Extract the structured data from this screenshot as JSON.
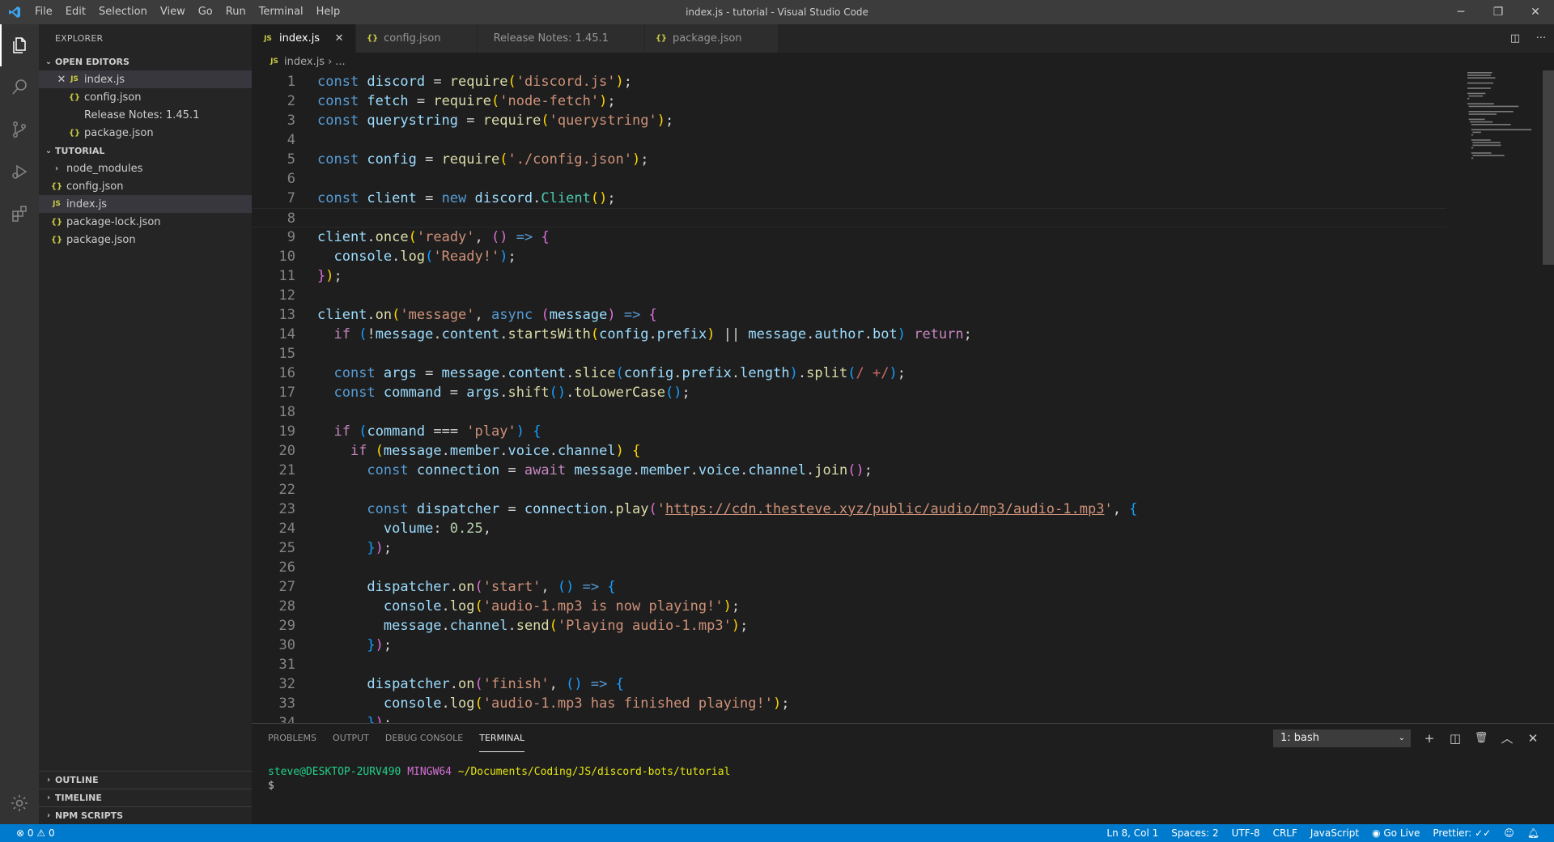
{
  "window": {
    "title": "index.js - tutorial - Visual Studio Code",
    "minimize": "─",
    "maximize": "❐",
    "close": "✕"
  },
  "menu": [
    "File",
    "Edit",
    "Selection",
    "View",
    "Go",
    "Run",
    "Terminal",
    "Help"
  ],
  "sidebar": {
    "title": "EXPLORER",
    "open_editors": {
      "header": "OPEN EDITORS",
      "items": [
        {
          "badge": "JS",
          "label": "index.js"
        },
        {
          "badge": "{}",
          "label": "config.json"
        },
        {
          "badge": "",
          "label": "Release Notes: 1.45.1"
        },
        {
          "badge": "{}",
          "label": "package.json"
        }
      ]
    },
    "workspace": {
      "header": "TUTORIAL",
      "items": [
        {
          "badge": "",
          "label": "node_modules"
        },
        {
          "badge": "{}",
          "label": "config.json"
        },
        {
          "badge": "JS",
          "label": "index.js"
        },
        {
          "badge": "{}",
          "label": "package-lock.json"
        },
        {
          "badge": "{}",
          "label": "package.json"
        }
      ]
    },
    "bottom_sections": [
      "OUTLINE",
      "TIMELINE",
      "NPM SCRIPTS"
    ]
  },
  "tabs": [
    {
      "badge": "JS",
      "label": "index.js"
    },
    {
      "badge": "{}",
      "label": "config.json"
    },
    {
      "badge": "",
      "label": "Release Notes: 1.45.1"
    },
    {
      "badge": "{}",
      "label": "package.json"
    }
  ],
  "tab_actions": {
    "split": "◫",
    "more": "···"
  },
  "breadcrumb": {
    "badge": "JS",
    "file": "index.js",
    "sep": "›",
    "rest": "..."
  },
  "code_lines": [
    [
      [
        "k",
        "const "
      ],
      [
        "v",
        "discord"
      ],
      [
        "o",
        " = "
      ],
      [
        "f",
        "require"
      ],
      [
        "p",
        "("
      ],
      [
        "s",
        "'discord.js'"
      ],
      [
        "p",
        ")"
      ],
      [
        "o",
        ";"
      ]
    ],
    [
      [
        "k",
        "const "
      ],
      [
        "v",
        "fetch"
      ],
      [
        "o",
        " = "
      ],
      [
        "f",
        "require"
      ],
      [
        "p",
        "("
      ],
      [
        "s",
        "'node-fetch'"
      ],
      [
        "p",
        ")"
      ],
      [
        "o",
        ";"
      ]
    ],
    [
      [
        "k",
        "const "
      ],
      [
        "v",
        "querystring"
      ],
      [
        "o",
        " = "
      ],
      [
        "f",
        "require"
      ],
      [
        "p",
        "("
      ],
      [
        "s",
        "'querystring'"
      ],
      [
        "p",
        ")"
      ],
      [
        "o",
        ";"
      ]
    ],
    [],
    [
      [
        "k",
        "const "
      ],
      [
        "v",
        "config"
      ],
      [
        "o",
        " = "
      ],
      [
        "f",
        "require"
      ],
      [
        "p",
        "("
      ],
      [
        "s",
        "'./config.json'"
      ],
      [
        "p",
        ")"
      ],
      [
        "o",
        ";"
      ]
    ],
    [],
    [
      [
        "k",
        "const "
      ],
      [
        "v",
        "client"
      ],
      [
        "o",
        " = "
      ],
      [
        "k",
        "new "
      ],
      [
        "v",
        "discord"
      ],
      [
        "o",
        "."
      ],
      [
        "cl",
        "Client"
      ],
      [
        "p",
        "()"
      ],
      [
        "o",
        ";"
      ]
    ],
    [],
    [
      [
        "v",
        "client"
      ],
      [
        "o",
        "."
      ],
      [
        "f",
        "once"
      ],
      [
        "p",
        "("
      ],
      [
        "s",
        "'ready'"
      ],
      [
        "o",
        ", "
      ],
      [
        "p2",
        "()"
      ],
      [
        "k",
        " => "
      ],
      [
        "p2",
        "{"
      ]
    ],
    [
      [
        "o",
        "  "
      ],
      [
        "v",
        "console"
      ],
      [
        "o",
        "."
      ],
      [
        "f",
        "log"
      ],
      [
        "p3",
        "("
      ],
      [
        "s",
        "'Ready!'"
      ],
      [
        "p3",
        ")"
      ],
      [
        "o",
        ";"
      ]
    ],
    [
      [
        "p2",
        "}"
      ],
      [
        "p",
        ")"
      ],
      [
        "o",
        ";"
      ]
    ],
    [],
    [
      [
        "v",
        "client"
      ],
      [
        "o",
        "."
      ],
      [
        "f",
        "on"
      ],
      [
        "p",
        "("
      ],
      [
        "s",
        "'message'"
      ],
      [
        "o",
        ", "
      ],
      [
        "k",
        "async "
      ],
      [
        "p2",
        "("
      ],
      [
        "v",
        "message"
      ],
      [
        "p2",
        ")"
      ],
      [
        "k",
        " => "
      ],
      [
        "p2",
        "{"
      ]
    ],
    [
      [
        "o",
        "  "
      ],
      [
        "c",
        "if "
      ],
      [
        "p3",
        "("
      ],
      [
        "o",
        "!"
      ],
      [
        "v",
        "message"
      ],
      [
        "o",
        "."
      ],
      [
        "v",
        "content"
      ],
      [
        "o",
        "."
      ],
      [
        "f",
        "startsWith"
      ],
      [
        "p",
        "("
      ],
      [
        "v",
        "config"
      ],
      [
        "o",
        "."
      ],
      [
        "v",
        "prefix"
      ],
      [
        "p",
        ")"
      ],
      [
        "o",
        " || "
      ],
      [
        "v",
        "message"
      ],
      [
        "o",
        "."
      ],
      [
        "v",
        "author"
      ],
      [
        "o",
        "."
      ],
      [
        "v",
        "bot"
      ],
      [
        "p3",
        ")"
      ],
      [
        "c",
        " return"
      ],
      [
        "o",
        ";"
      ]
    ],
    [],
    [
      [
        "o",
        "  "
      ],
      [
        "k",
        "const "
      ],
      [
        "v",
        "args"
      ],
      [
        "o",
        " = "
      ],
      [
        "v",
        "message"
      ],
      [
        "o",
        "."
      ],
      [
        "v",
        "content"
      ],
      [
        "o",
        "."
      ],
      [
        "f",
        "slice"
      ],
      [
        "p3",
        "("
      ],
      [
        "v",
        "config"
      ],
      [
        "o",
        "."
      ],
      [
        "v",
        "prefix"
      ],
      [
        "o",
        "."
      ],
      [
        "v",
        "length"
      ],
      [
        "p3",
        ")"
      ],
      [
        "o",
        "."
      ],
      [
        "f",
        "split"
      ],
      [
        "p3",
        "("
      ],
      [
        "r",
        "/ +/"
      ],
      [
        "p3",
        ")"
      ],
      [
        "o",
        ";"
      ]
    ],
    [
      [
        "o",
        "  "
      ],
      [
        "k",
        "const "
      ],
      [
        "v",
        "command"
      ],
      [
        "o",
        " = "
      ],
      [
        "v",
        "args"
      ],
      [
        "o",
        "."
      ],
      [
        "f",
        "shift"
      ],
      [
        "p3",
        "()"
      ],
      [
        "o",
        "."
      ],
      [
        "f",
        "toLowerCase"
      ],
      [
        "p3",
        "()"
      ],
      [
        "o",
        ";"
      ]
    ],
    [],
    [
      [
        "o",
        "  "
      ],
      [
        "c",
        "if "
      ],
      [
        "p3",
        "("
      ],
      [
        "v",
        "command"
      ],
      [
        "o",
        " === "
      ],
      [
        "s",
        "'play'"
      ],
      [
        "p3",
        ")"
      ],
      [
        "p3",
        " {"
      ]
    ],
    [
      [
        "o",
        "    "
      ],
      [
        "c",
        "if "
      ],
      [
        "p",
        "("
      ],
      [
        "v",
        "message"
      ],
      [
        "o",
        "."
      ],
      [
        "v",
        "member"
      ],
      [
        "o",
        "."
      ],
      [
        "v",
        "voice"
      ],
      [
        "o",
        "."
      ],
      [
        "v",
        "channel"
      ],
      [
        "p",
        ")"
      ],
      [
        "p",
        " {"
      ]
    ],
    [
      [
        "o",
        "      "
      ],
      [
        "k",
        "const "
      ],
      [
        "v",
        "connection"
      ],
      [
        "o",
        " = "
      ],
      [
        "c",
        "await "
      ],
      [
        "v",
        "message"
      ],
      [
        "o",
        "."
      ],
      [
        "v",
        "member"
      ],
      [
        "o",
        "."
      ],
      [
        "v",
        "voice"
      ],
      [
        "o",
        "."
      ],
      [
        "v",
        "channel"
      ],
      [
        "o",
        "."
      ],
      [
        "f",
        "join"
      ],
      [
        "p2",
        "()"
      ],
      [
        "o",
        ";"
      ]
    ],
    [],
    [
      [
        "o",
        "      "
      ],
      [
        "k",
        "const "
      ],
      [
        "v",
        "dispatcher"
      ],
      [
        "o",
        " = "
      ],
      [
        "v",
        "connection"
      ],
      [
        "o",
        "."
      ],
      [
        "f",
        "play"
      ],
      [
        "p2",
        "("
      ],
      [
        "s",
        "'"
      ],
      [
        "su",
        "https://cdn.thesteve.xyz/public/audio/mp3/audio-1.mp3"
      ],
      [
        "s",
        "'"
      ],
      [
        "o",
        ", "
      ],
      [
        "p3",
        "{"
      ]
    ],
    [
      [
        "o",
        "        "
      ],
      [
        "v",
        "volume"
      ],
      [
        "o",
        ": "
      ],
      [
        "n",
        "0.25"
      ],
      [
        "o",
        ","
      ]
    ],
    [
      [
        "o",
        "      "
      ],
      [
        "p3",
        "}"
      ],
      [
        "p2",
        ")"
      ],
      [
        "o",
        ";"
      ]
    ],
    [],
    [
      [
        "o",
        "      "
      ],
      [
        "v",
        "dispatcher"
      ],
      [
        "o",
        "."
      ],
      [
        "f",
        "on"
      ],
      [
        "p2",
        "("
      ],
      [
        "s",
        "'start'"
      ],
      [
        "o",
        ", "
      ],
      [
        "p3",
        "()"
      ],
      [
        "k",
        " => "
      ],
      [
        "p3",
        "{"
      ]
    ],
    [
      [
        "o",
        "        "
      ],
      [
        "v",
        "console"
      ],
      [
        "o",
        "."
      ],
      [
        "f",
        "log"
      ],
      [
        "p",
        "("
      ],
      [
        "s",
        "'audio-1.mp3 is now playing!'"
      ],
      [
        "p",
        ")"
      ],
      [
        "o",
        ";"
      ]
    ],
    [
      [
        "o",
        "        "
      ],
      [
        "v",
        "message"
      ],
      [
        "o",
        "."
      ],
      [
        "v",
        "channel"
      ],
      [
        "o",
        "."
      ],
      [
        "f",
        "send"
      ],
      [
        "p",
        "("
      ],
      [
        "s",
        "'Playing audio-1.mp3'"
      ],
      [
        "p",
        ")"
      ],
      [
        "o",
        ";"
      ]
    ],
    [
      [
        "o",
        "      "
      ],
      [
        "p3",
        "}"
      ],
      [
        "p2",
        ")"
      ],
      [
        "o",
        ";"
      ]
    ],
    [],
    [
      [
        "o",
        "      "
      ],
      [
        "v",
        "dispatcher"
      ],
      [
        "o",
        "."
      ],
      [
        "f",
        "on"
      ],
      [
        "p2",
        "("
      ],
      [
        "s",
        "'finish'"
      ],
      [
        "o",
        ", "
      ],
      [
        "p3",
        "()"
      ],
      [
        "k",
        " => "
      ],
      [
        "p3",
        "{"
      ]
    ],
    [
      [
        "o",
        "        "
      ],
      [
        "v",
        "console"
      ],
      [
        "o",
        "."
      ],
      [
        "f",
        "log"
      ],
      [
        "p",
        "("
      ],
      [
        "s",
        "'audio-1.mp3 has finished playing!'"
      ],
      [
        "p",
        ")"
      ],
      [
        "o",
        ";"
      ]
    ],
    [
      [
        "o",
        "      "
      ],
      [
        "p3",
        "}"
      ],
      [
        "p2",
        ")"
      ],
      [
        "o",
        ";"
      ]
    ]
  ],
  "current_line": 8,
  "panel": {
    "tabs": [
      "PROBLEMS",
      "OUTPUT",
      "DEBUG CONSOLE",
      "TERMINAL"
    ],
    "active_tab": "TERMINAL",
    "terminal_select": "1: bash",
    "actions": {
      "add": "+",
      "split": "◫",
      "trash": "🗑",
      "maximize": "︿",
      "close": "✕"
    },
    "terminal": {
      "user": "steve@DESKTOP-2URV490",
      "host": "MINGW64",
      "path": "~/Documents/Coding/JS/discord-bots/tutorial",
      "prompt": "$"
    }
  },
  "status": {
    "errors": "0",
    "warnings": "0",
    "position": "Ln 8, Col 1",
    "spaces": "Spaces: 2",
    "encoding": "UTF-8",
    "eol": "CRLF",
    "language": "JavaScript",
    "golive": "Go Live",
    "prettier": "Prettier: ✓✓"
  },
  "colors": {
    "accent": "#007acc",
    "activitybar": "#333333",
    "sidebar": "#252526",
    "editor": "#1e1e1e"
  }
}
